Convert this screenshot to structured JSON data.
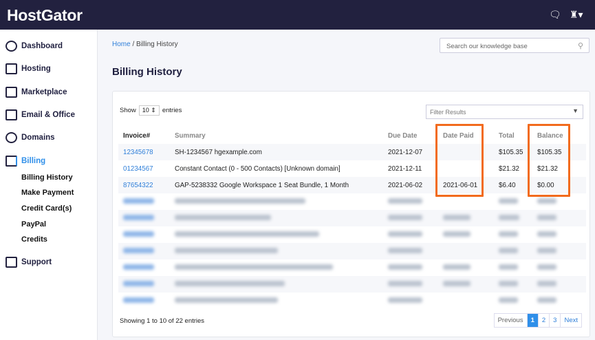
{
  "header": {
    "logo": "HostGator"
  },
  "sidebar": {
    "items": [
      {
        "label": "Dashboard"
      },
      {
        "label": "Hosting"
      },
      {
        "label": "Marketplace"
      },
      {
        "label": "Email & Office"
      },
      {
        "label": "Domains"
      },
      {
        "label": "Billing"
      }
    ],
    "billing_sub": [
      "Billing History",
      "Make Payment",
      "Credit Card(s)",
      "PayPal",
      "Credits"
    ],
    "support": "Support"
  },
  "breadcrumb": {
    "home": "Home",
    "sep": "/",
    "current": "Billing History"
  },
  "search": {
    "placeholder": "Search our knowledge base"
  },
  "page_title": "Billing History",
  "table_controls": {
    "show": "Show",
    "entries_value": "10",
    "entries": "entries",
    "filter_placeholder": "Filter Results"
  },
  "columns": [
    "Invoice#",
    "Summary",
    "Due Date",
    "Date Paid",
    "Total",
    "Balance"
  ],
  "rows": [
    {
      "invoice": "12345678",
      "summary": "SH-1234567 hgexample.com",
      "due": "2021-12-07",
      "paid": "",
      "total": "$105.35",
      "balance": "$105.35"
    },
    {
      "invoice": "01234567",
      "summary": "Constant Contact (0 - 500 Contacts) [Unknown domain]",
      "due": "2021-12-11",
      "paid": "",
      "total": "$21.32",
      "balance": "$21.32"
    },
    {
      "invoice": "87654322",
      "summary": "GAP-5238332 Google Workspace 1 Seat Bundle, 1 Month",
      "due": "2021-06-02",
      "paid": "2021-06-01",
      "total": "$6.40",
      "balance": "$0.00"
    }
  ],
  "footer": {
    "info": "Showing 1 to 10 of 22 entries",
    "pages": [
      "Previous",
      "1",
      "2",
      "3",
      "Next"
    ]
  },
  "colors": {
    "header": "#22213f",
    "accent": "#2f8fe9",
    "highlight": "#f26b1d"
  }
}
